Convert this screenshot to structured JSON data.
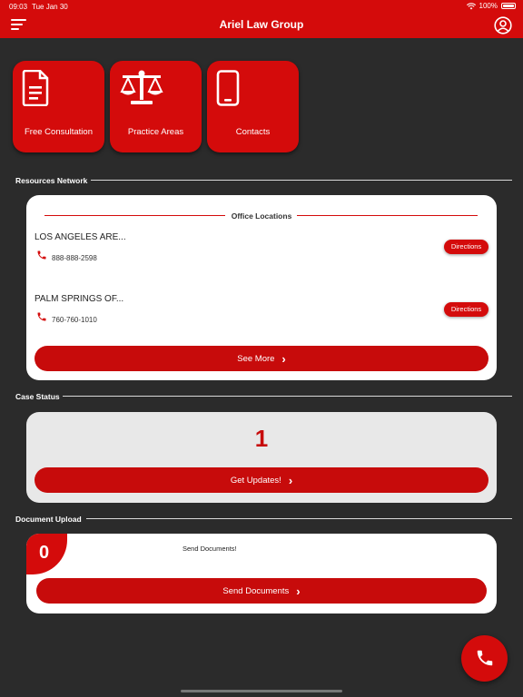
{
  "status_bar": {
    "time": "09:03",
    "date": "Tue Jan 30",
    "battery": "100%"
  },
  "header": {
    "title": "Ariel Law Group"
  },
  "tiles": [
    {
      "label": "Free Consultation",
      "icon": "document-icon"
    },
    {
      "label": "Practice Areas",
      "icon": "scales-icon"
    },
    {
      "label": "Contacts",
      "icon": "phone-device-icon"
    }
  ],
  "resources": {
    "section_title": "Resources Network",
    "card_title": "Office Locations",
    "offices": [
      {
        "name": "LOS ANGELES ARE...",
        "phone": "888-888-2598",
        "button": "Directions"
      },
      {
        "name": "PALM SPRINGS OF...",
        "phone": "760-760-1010",
        "button": "Directions"
      }
    ],
    "see_more": "See More"
  },
  "case_status": {
    "section_title": "Case Status",
    "count": "1",
    "button": "Get Updates!"
  },
  "document_upload": {
    "section_title": "Document Upload",
    "count": "0",
    "text": "Send Documents!",
    "button": "Send Documents"
  },
  "colors": {
    "brand_red": "#d40b0b",
    "background": "#2b2b2b"
  }
}
